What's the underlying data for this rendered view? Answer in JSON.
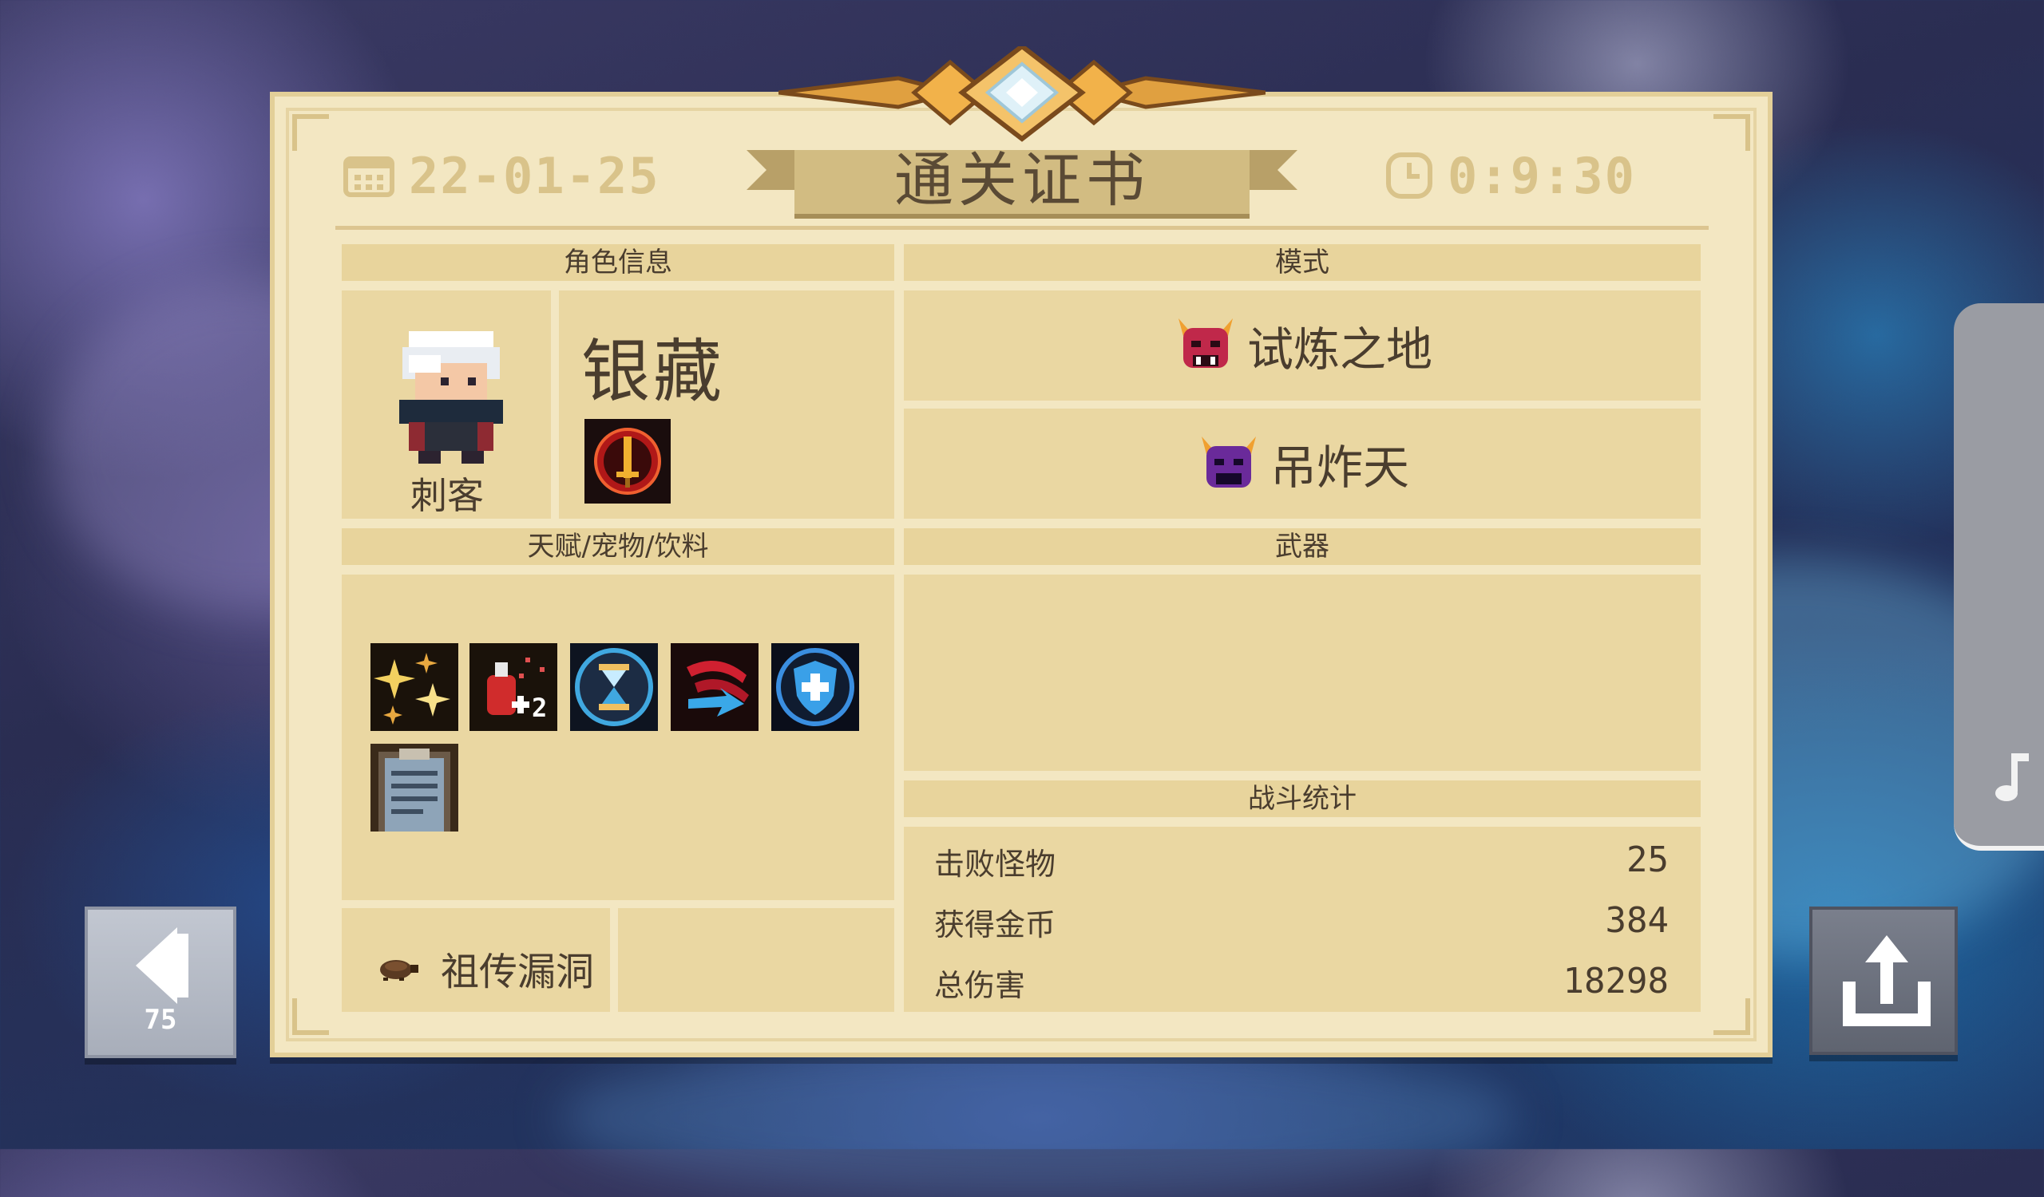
{
  "header": {
    "date": "22-01-25",
    "title": "通关证书",
    "time": "0:9:30"
  },
  "character": {
    "section_label": "角色信息",
    "name": "银藏",
    "class": "刺客"
  },
  "mode": {
    "section_label": "模式",
    "items": [
      "试炼之地",
      "吊炸天"
    ]
  },
  "buffs": {
    "section_label": "天赋/宠物/饮料",
    "icons": [
      "sparkle-burst-icon",
      "potion-plus-two-icon",
      "hourglass-icon",
      "claw-dash-icon",
      "shield-cross-icon",
      "clipboard-icon"
    ],
    "bug_label": "祖传漏洞"
  },
  "weapons": {
    "section_label": "武器"
  },
  "stats": {
    "section_label": "战斗统计",
    "rows": [
      {
        "label": "击败怪物",
        "value": "25"
      },
      {
        "label": "获得金币",
        "value": "384"
      },
      {
        "label": "总伤害",
        "value": "18298"
      }
    ]
  },
  "controls": {
    "back_count": "75"
  },
  "colors": {
    "paper": "#f3e7c2",
    "panel": "#ead7a2",
    "header_bar": "#e8d49c",
    "gold": "#d9c38a",
    "text": "#4a3d2e"
  }
}
